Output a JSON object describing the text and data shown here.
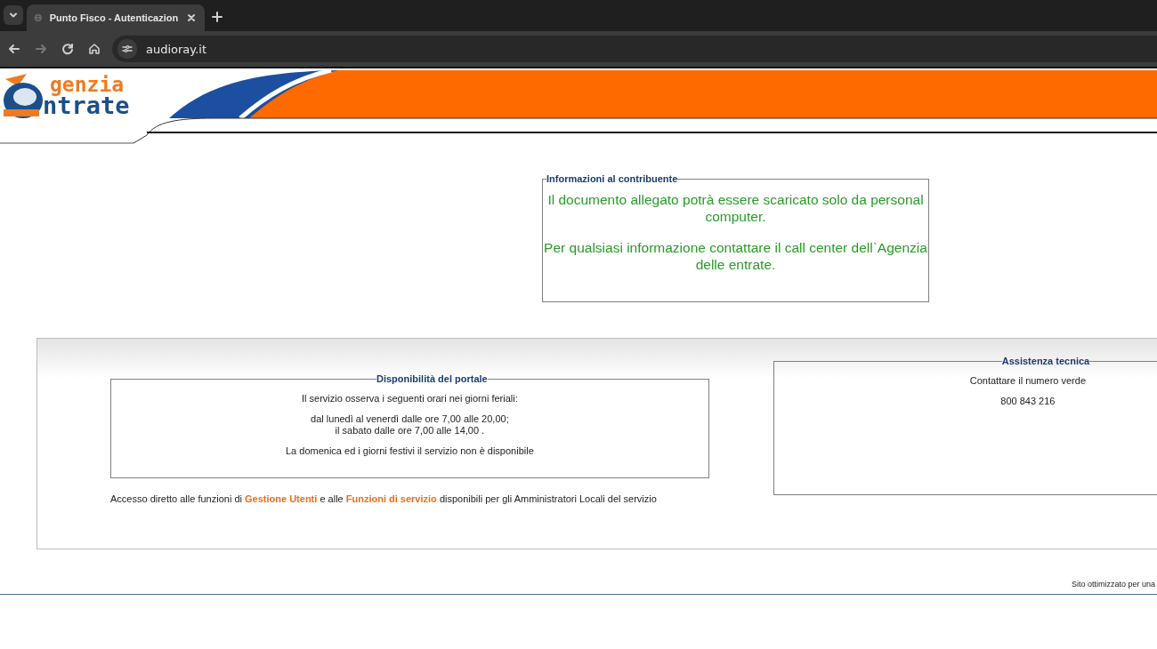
{
  "browser": {
    "tabs": [
      {
        "title": "Punto Fisco - Autenticazion",
        "selected": true
      }
    ],
    "address": "audioray.it",
    "forward_disabled": true
  },
  "header": {
    "logo_line_1": "genzia",
    "logo_line_2": "ntrate"
  },
  "info_box": {
    "legend": "Informazioni al contribuente",
    "paragraphs": [
      "Il documento allegato potrà essere scaricato solo da personal computer.",
      "Per qualsiasi informazione contattare il call center dell`Agenzia delle entrate."
    ]
  },
  "availability_box": {
    "legend": "Disponibilità del portale",
    "paragraphs": [
      "Il servizio osserva i seguenti orari nei giorni feriali:",
      "dal lunedì al venerdì dalle ore 7,00 alle 20,00;\nil sabato dalle ore 7,00 alle 14,00 .",
      "La domenica ed i giorni festivi il servizio non è disponibile"
    ]
  },
  "access_note": {
    "before": "Accesso diretto alle funzioni di",
    "link_1": "Gestione Utenti",
    "middle": "e alle",
    "link_2": "Funzioni di servizio",
    "after": "disponibili per gli Amministratori Locali del servizio"
  },
  "support_box": {
    "legend": "Assistenza tecnica",
    "lines": [
      "Contattare il numero verde",
      "800 843 216"
    ]
  },
  "footer": {
    "note": "Sito ottimizzato per una"
  }
}
